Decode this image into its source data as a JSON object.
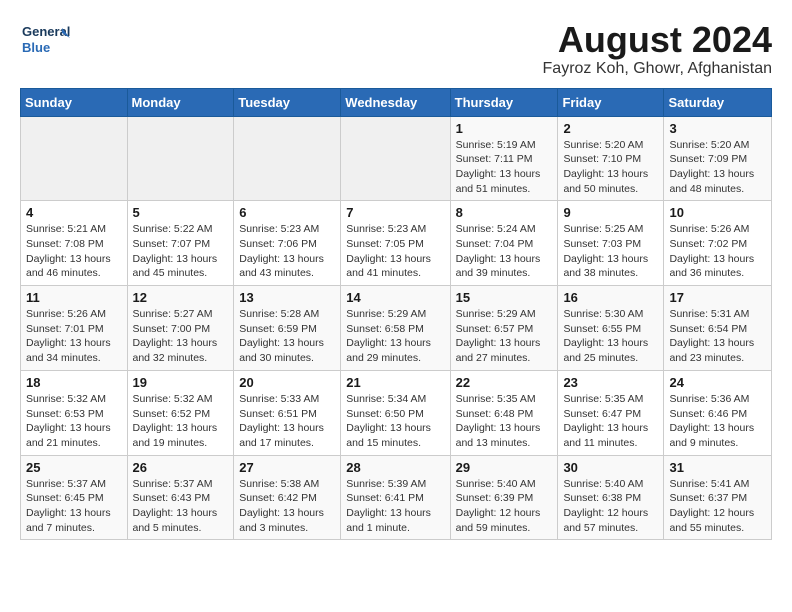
{
  "header": {
    "logo_line1": "General",
    "logo_line2": "Blue",
    "month_year": "August 2024",
    "location": "Fayroz Koh, Ghowr, Afghanistan"
  },
  "days_of_week": [
    "Sunday",
    "Monday",
    "Tuesday",
    "Wednesday",
    "Thursday",
    "Friday",
    "Saturday"
  ],
  "weeks": [
    [
      {
        "day": "",
        "info": ""
      },
      {
        "day": "",
        "info": ""
      },
      {
        "day": "",
        "info": ""
      },
      {
        "day": "",
        "info": ""
      },
      {
        "day": "1",
        "info": "Sunrise: 5:19 AM\nSunset: 7:11 PM\nDaylight: 13 hours and 51 minutes."
      },
      {
        "day": "2",
        "info": "Sunrise: 5:20 AM\nSunset: 7:10 PM\nDaylight: 13 hours and 50 minutes."
      },
      {
        "day": "3",
        "info": "Sunrise: 5:20 AM\nSunset: 7:09 PM\nDaylight: 13 hours and 48 minutes."
      }
    ],
    [
      {
        "day": "4",
        "info": "Sunrise: 5:21 AM\nSunset: 7:08 PM\nDaylight: 13 hours and 46 minutes."
      },
      {
        "day": "5",
        "info": "Sunrise: 5:22 AM\nSunset: 7:07 PM\nDaylight: 13 hours and 45 minutes."
      },
      {
        "day": "6",
        "info": "Sunrise: 5:23 AM\nSunset: 7:06 PM\nDaylight: 13 hours and 43 minutes."
      },
      {
        "day": "7",
        "info": "Sunrise: 5:23 AM\nSunset: 7:05 PM\nDaylight: 13 hours and 41 minutes."
      },
      {
        "day": "8",
        "info": "Sunrise: 5:24 AM\nSunset: 7:04 PM\nDaylight: 13 hours and 39 minutes."
      },
      {
        "day": "9",
        "info": "Sunrise: 5:25 AM\nSunset: 7:03 PM\nDaylight: 13 hours and 38 minutes."
      },
      {
        "day": "10",
        "info": "Sunrise: 5:26 AM\nSunset: 7:02 PM\nDaylight: 13 hours and 36 minutes."
      }
    ],
    [
      {
        "day": "11",
        "info": "Sunrise: 5:26 AM\nSunset: 7:01 PM\nDaylight: 13 hours and 34 minutes."
      },
      {
        "day": "12",
        "info": "Sunrise: 5:27 AM\nSunset: 7:00 PM\nDaylight: 13 hours and 32 minutes."
      },
      {
        "day": "13",
        "info": "Sunrise: 5:28 AM\nSunset: 6:59 PM\nDaylight: 13 hours and 30 minutes."
      },
      {
        "day": "14",
        "info": "Sunrise: 5:29 AM\nSunset: 6:58 PM\nDaylight: 13 hours and 29 minutes."
      },
      {
        "day": "15",
        "info": "Sunrise: 5:29 AM\nSunset: 6:57 PM\nDaylight: 13 hours and 27 minutes."
      },
      {
        "day": "16",
        "info": "Sunrise: 5:30 AM\nSunset: 6:55 PM\nDaylight: 13 hours and 25 minutes."
      },
      {
        "day": "17",
        "info": "Sunrise: 5:31 AM\nSunset: 6:54 PM\nDaylight: 13 hours and 23 minutes."
      }
    ],
    [
      {
        "day": "18",
        "info": "Sunrise: 5:32 AM\nSunset: 6:53 PM\nDaylight: 13 hours and 21 minutes."
      },
      {
        "day": "19",
        "info": "Sunrise: 5:32 AM\nSunset: 6:52 PM\nDaylight: 13 hours and 19 minutes."
      },
      {
        "day": "20",
        "info": "Sunrise: 5:33 AM\nSunset: 6:51 PM\nDaylight: 13 hours and 17 minutes."
      },
      {
        "day": "21",
        "info": "Sunrise: 5:34 AM\nSunset: 6:50 PM\nDaylight: 13 hours and 15 minutes."
      },
      {
        "day": "22",
        "info": "Sunrise: 5:35 AM\nSunset: 6:48 PM\nDaylight: 13 hours and 13 minutes."
      },
      {
        "day": "23",
        "info": "Sunrise: 5:35 AM\nSunset: 6:47 PM\nDaylight: 13 hours and 11 minutes."
      },
      {
        "day": "24",
        "info": "Sunrise: 5:36 AM\nSunset: 6:46 PM\nDaylight: 13 hours and 9 minutes."
      }
    ],
    [
      {
        "day": "25",
        "info": "Sunrise: 5:37 AM\nSunset: 6:45 PM\nDaylight: 13 hours and 7 minutes."
      },
      {
        "day": "26",
        "info": "Sunrise: 5:37 AM\nSunset: 6:43 PM\nDaylight: 13 hours and 5 minutes."
      },
      {
        "day": "27",
        "info": "Sunrise: 5:38 AM\nSunset: 6:42 PM\nDaylight: 13 hours and 3 minutes."
      },
      {
        "day": "28",
        "info": "Sunrise: 5:39 AM\nSunset: 6:41 PM\nDaylight: 13 hours and 1 minute."
      },
      {
        "day": "29",
        "info": "Sunrise: 5:40 AM\nSunset: 6:39 PM\nDaylight: 12 hours and 59 minutes."
      },
      {
        "day": "30",
        "info": "Sunrise: 5:40 AM\nSunset: 6:38 PM\nDaylight: 12 hours and 57 minutes."
      },
      {
        "day": "31",
        "info": "Sunrise: 5:41 AM\nSunset: 6:37 PM\nDaylight: 12 hours and 55 minutes."
      }
    ]
  ]
}
